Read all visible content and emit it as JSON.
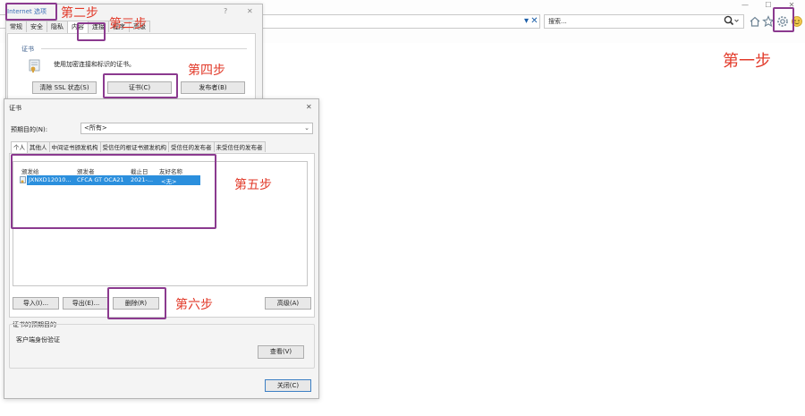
{
  "browser": {
    "search_placeholder": "搜索...",
    "dropdown_glyph": "▾",
    "go_glyph": "✕"
  },
  "inet_options": {
    "title": "Internet 选项",
    "help_glyph": "?",
    "close_glyph": "✕",
    "tabs": [
      "常规",
      "安全",
      "隐私",
      "内容",
      "连接",
      "程序",
      "高级"
    ],
    "section_title": "证书",
    "description": "使用加密连接和标识的证书。",
    "buttons": {
      "clear_ssl": "清除 SSL 状态(S)",
      "certificates": "证书(C)",
      "publishers": "发布者(B)"
    }
  },
  "cert_dialog": {
    "title": "证书",
    "close_glyph": "✕",
    "purpose_label": "预期目的(N):",
    "purpose_value": "<所有>",
    "tabs": [
      "个人",
      "其他人",
      "中间证书颁发机构",
      "受信任的根证书颁发机构",
      "受信任的发布者",
      "未受信任的发布者"
    ],
    "columns": [
      "颁发给",
      "颁发者",
      "截止日",
      "友好名称"
    ],
    "rows": [
      {
        "issued_to": "JXNXD12010...",
        "issued_by": "CFCA GT OCA21",
        "expiry": "2021-...",
        "friendly_name": "<无>"
      }
    ],
    "buttons": {
      "import": "导入(I)...",
      "export": "导出(E)...",
      "remove": "删除(R)",
      "advanced": "高级(A)",
      "view": "查看(V)",
      "close": "关闭(C)"
    },
    "purposes_title": "证书的预期目的",
    "purposes_value": "客户端身份验证"
  },
  "annotations": {
    "step1": "第一步",
    "step2": "第二步",
    "step3": "第三步",
    "step4": "第四步",
    "step5": "第五步",
    "step6": "第六步",
    "color": "#e23a2a",
    "box_color": "#8b3a8f"
  }
}
